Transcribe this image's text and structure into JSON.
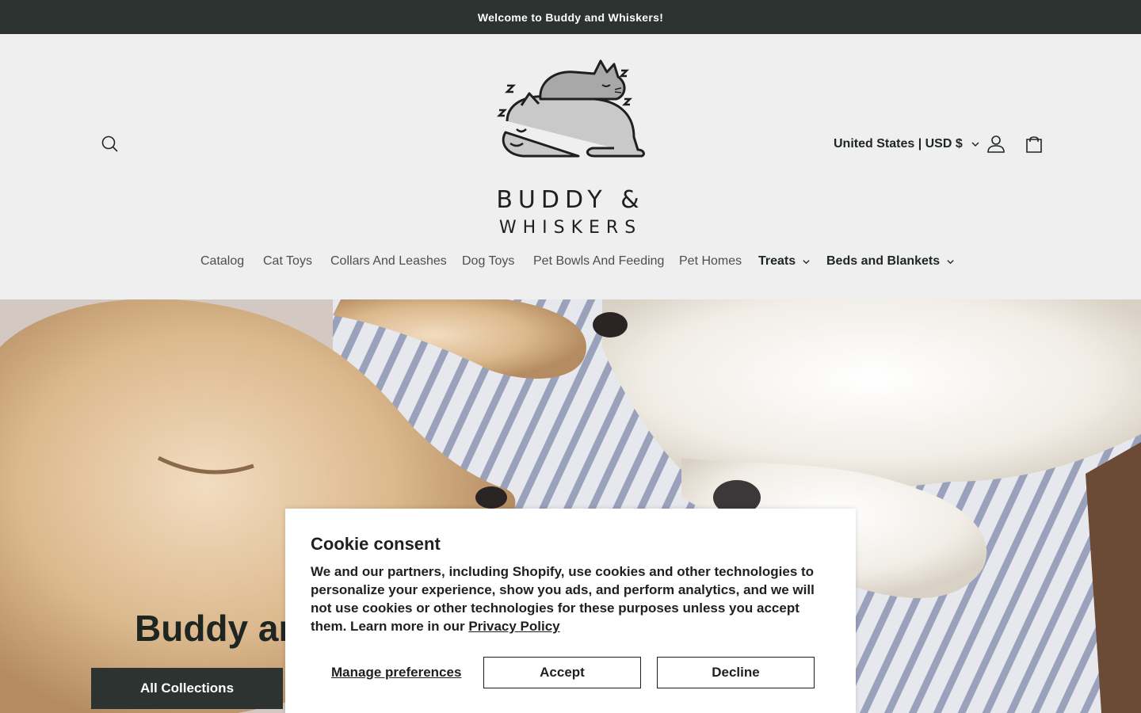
{
  "announcement": {
    "text": "Welcome to Buddy and Whiskers!"
  },
  "header": {
    "logo": {
      "line1": "BUDDY &",
      "line2": "WHISKERS"
    },
    "country_selector": {
      "label": "United States | USD $"
    },
    "icons": {
      "search": "search-icon",
      "account": "user-icon",
      "cart": "bag-icon"
    }
  },
  "nav": {
    "items": [
      {
        "label": "Catalog",
        "has_dropdown": false
      },
      {
        "label": "Cat Toys",
        "has_dropdown": false
      },
      {
        "label": "Collars And Leashes",
        "has_dropdown": false
      },
      {
        "label": "Dog Toys",
        "has_dropdown": false
      },
      {
        "label": "Pet Bowls And Feeding",
        "has_dropdown": false
      },
      {
        "label": "Pet Homes",
        "has_dropdown": false
      },
      {
        "label": "Treats",
        "has_dropdown": true
      },
      {
        "label": "Beds and Blankets",
        "has_dropdown": true
      }
    ]
  },
  "hero": {
    "title": "Buddy and",
    "button_label": "All Collections"
  },
  "cookie": {
    "title": "Cookie consent",
    "body": "We and our partners, including Shopify, use cookies and other technologies to personalize your experience, show you ads, and perform analytics, and we will not use cookies or other technologies for these purposes unless you accept them. Learn more in our ",
    "link_label": "Privacy Policy",
    "manage_label": "Manage preferences",
    "accept_label": "Accept",
    "decline_label": "Decline"
  },
  "colors": {
    "dark": "#2c3330",
    "background": "#efefef",
    "text": "#1f2622"
  }
}
